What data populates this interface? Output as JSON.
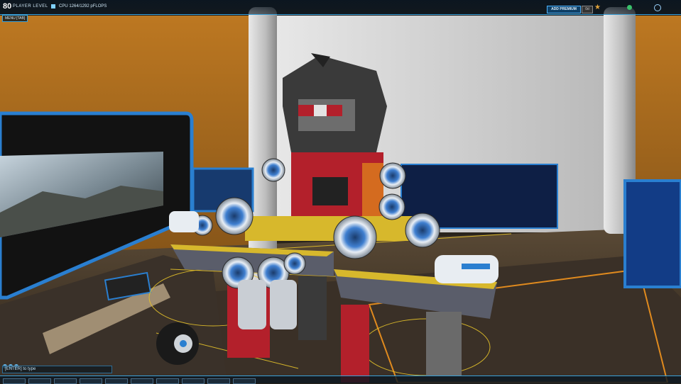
{
  "hud": {
    "player_level": "80",
    "player_level_label": "PLAYER LEVEL",
    "cpu_text": "CPU 1264/1292 pFLOPS",
    "menu_tab": "MENU [TAB]",
    "premium_button": "ADD PREMIUM",
    "premium_value": "0d",
    "chat_placeholder": "[ENTER] to type"
  },
  "icons": {
    "cpu": "cpu-icon",
    "star": "star-icon",
    "friends": "friends-icon",
    "globe": "globe-icon"
  },
  "colors": {
    "hud_accent": "#3aa0d8",
    "premium_bg": "#0e3f66",
    "robot_red": "#b3202b",
    "robot_yellow": "#d7b82c",
    "wall_orange": "#b8741f"
  }
}
